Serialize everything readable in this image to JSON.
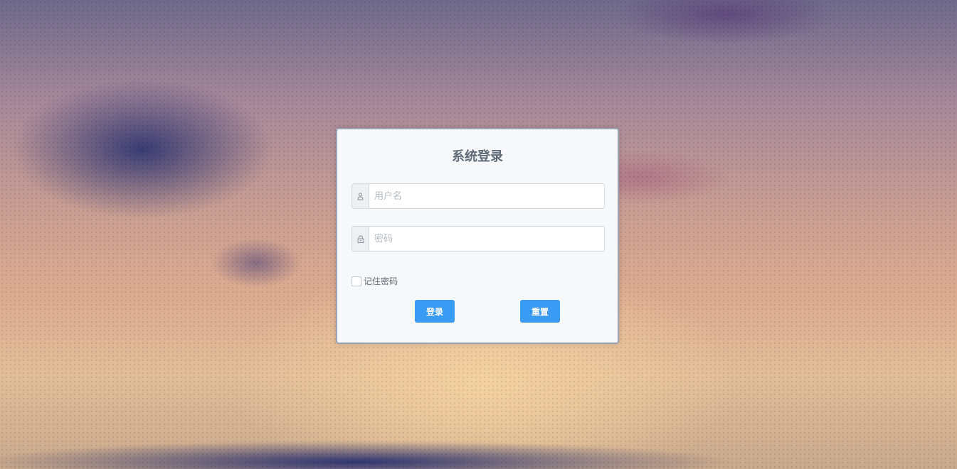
{
  "login_form": {
    "title": "系统登录",
    "username_placeholder": "用户名",
    "username_value": "",
    "password_placeholder": "密码",
    "password_value": "",
    "remember_label": "记住密码",
    "remember_checked": false,
    "login_button": "登录",
    "reset_button": "重置",
    "username_icon": "user-icon",
    "password_icon": "lock-icon"
  },
  "colors": {
    "accent": "#3a9bf5",
    "panel_background": "#f7f8fa",
    "title_text": "#606a78"
  }
}
